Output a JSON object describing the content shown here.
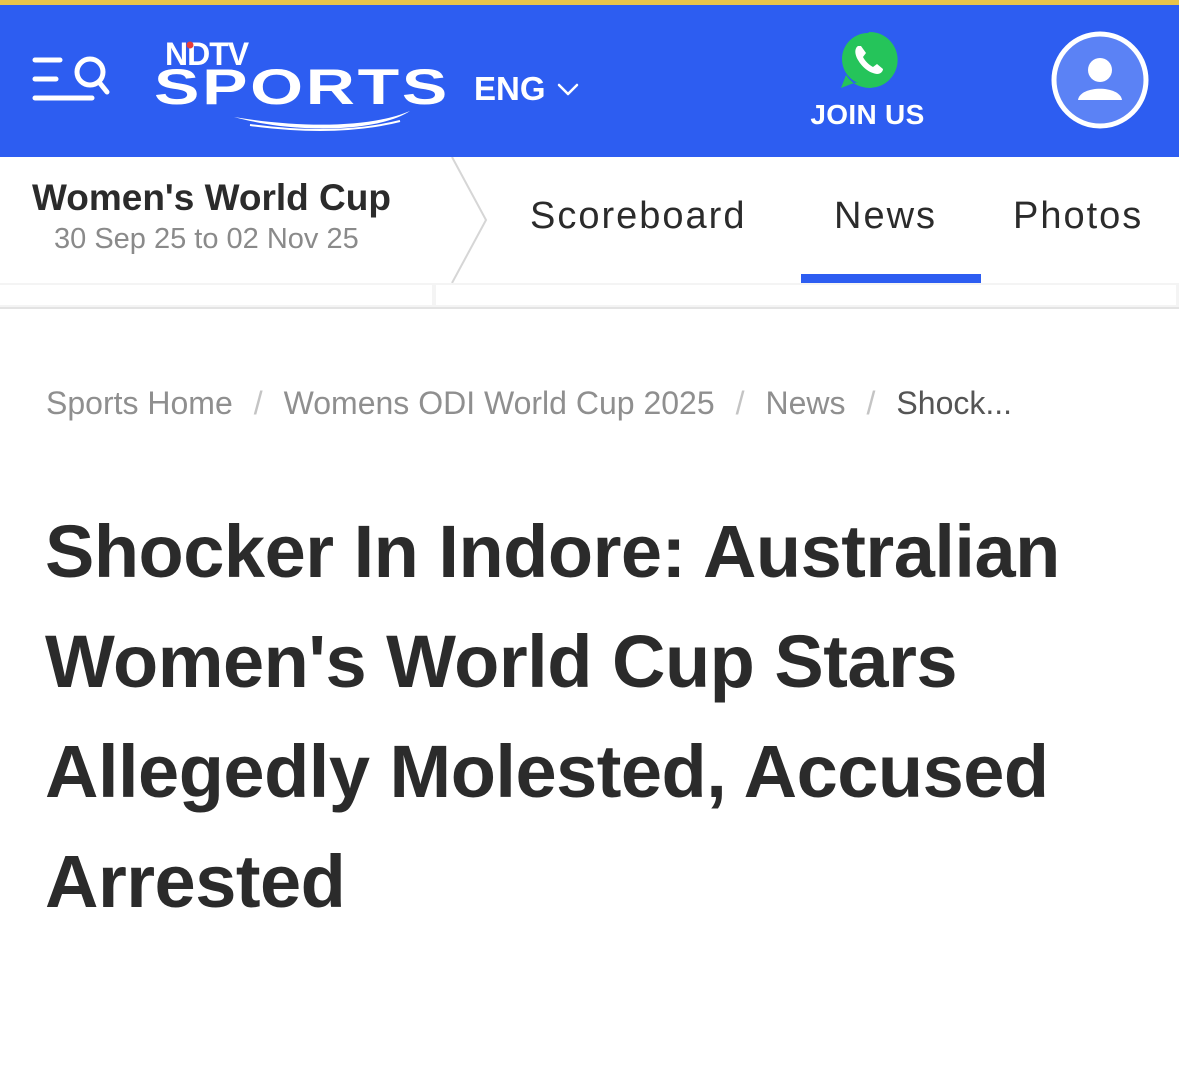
{
  "colors": {
    "header_bg": "#2d5df1",
    "top_strip": "#e9c449",
    "whatsapp_green": "#25c45a",
    "accent_underline": "#2d5df1",
    "headline_text": "#2b2b2b",
    "breadcrumb_text": "#8f8f8f"
  },
  "header": {
    "logo_top": "NDTV",
    "logo_bottom": "SPORTS",
    "language": "ENG",
    "join_label": "JOIN US",
    "icons": [
      "menu-search-icon",
      "chevron-down-icon",
      "whatsapp-icon",
      "user-icon"
    ]
  },
  "series": {
    "title": "Women's World Cup",
    "dates": "30 Sep 25 to 02 Nov 25"
  },
  "tabs": [
    {
      "label": "Scoreboard",
      "active": false
    },
    {
      "label": "News",
      "active": true
    },
    {
      "label": "Photos",
      "active": false
    }
  ],
  "breadcrumb": {
    "items": [
      "Sports Home",
      "Womens ODI World Cup 2025",
      "News"
    ],
    "current": "Shock...",
    "separator": "/"
  },
  "article": {
    "headline": "Shocker In Indore: Australian Women's World Cup Stars Allegedly Molested, Accused Arrested"
  }
}
